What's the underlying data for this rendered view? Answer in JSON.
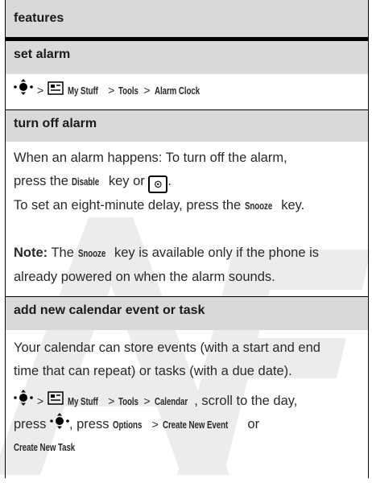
{
  "header": {
    "title": "features"
  },
  "sections": {
    "set_alarm": {
      "title": "set alarm",
      "path": {
        "my_stuff": "My Stuff",
        "tools": "Tools",
        "item": "Alarm Clock"
      }
    },
    "turn_off": {
      "title": "turn off alarm",
      "line1": "When an alarm happens: To turn off the alarm,",
      "line2_a": "press the",
      "disable_key": "Disable",
      "line2_b": "key or",
      "line2_c": ".",
      "line3_a": "To set an eight-minute delay, press the",
      "snooze_key": "Snooze",
      "line3_b": "key.",
      "note_label": "Note:",
      "note_a": "The",
      "note_snooze": "Snooze",
      "note_b": "key is available only if the phone is",
      "note_c": "already powered on when the alarm sounds."
    },
    "calendar": {
      "title": "add new calendar event or task",
      "line1": "Your calendar can store events (with a start and end",
      "line2": "time that can repeat) or tasks (with a due date).",
      "path": {
        "my_stuff": "My Stuff",
        "tools": "Tools",
        "item": "Calendar"
      },
      "scroll_text": ", scroll to the day,",
      "press_a": "press",
      "press_b": ", press",
      "options": "Options",
      "create_event": "Create New Event",
      "or_text": "or",
      "create_task": "Create New Task"
    }
  },
  "icons": {
    "nav": "nav-key-icon",
    "menu": "menu-icon",
    "power": "power-key-icon"
  },
  "colors": {
    "band": "#d9d9d9",
    "watermark": "#ececec"
  }
}
